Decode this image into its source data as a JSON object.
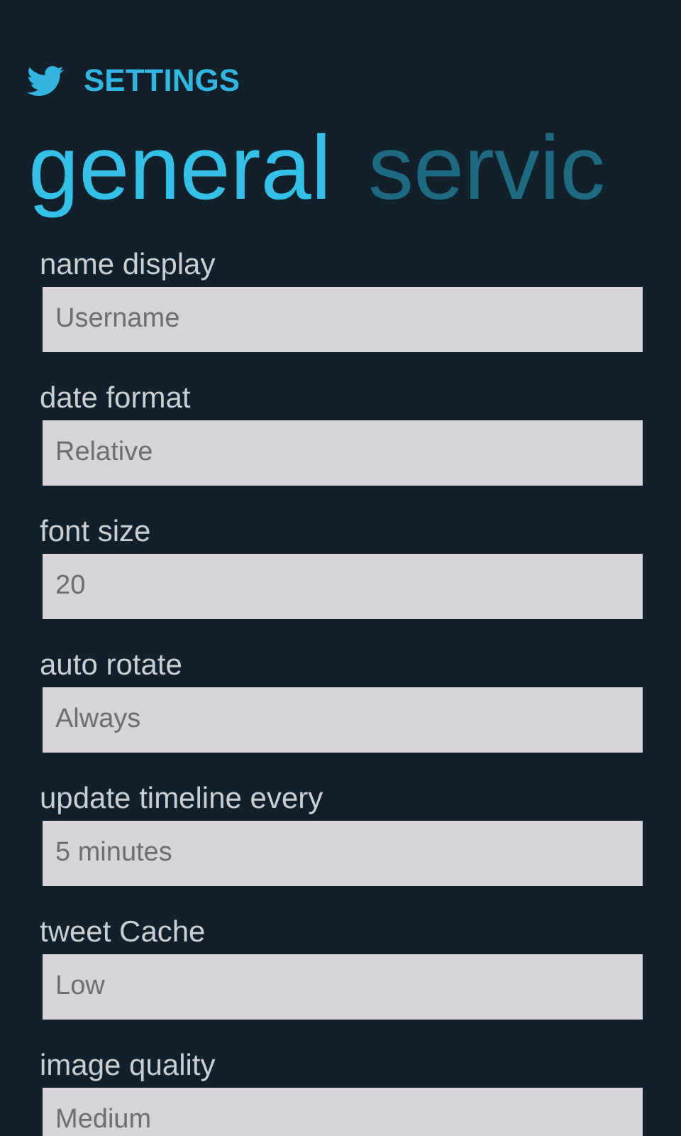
{
  "app_title": "SETTINGS",
  "pivot": [
    {
      "label": "general",
      "selected": true
    },
    {
      "label": "servic",
      "selected": false
    }
  ],
  "settings": [
    {
      "label": "name display",
      "value": "Username"
    },
    {
      "label": "date format",
      "value": "Relative"
    },
    {
      "label": "font size",
      "value": "20"
    },
    {
      "label": "auto rotate",
      "value": "Always"
    },
    {
      "label": "update timeline every",
      "value": "5 minutes"
    },
    {
      "label": "tweet Cache",
      "value": "Low"
    },
    {
      "label": "image quality",
      "value": "Medium"
    }
  ]
}
